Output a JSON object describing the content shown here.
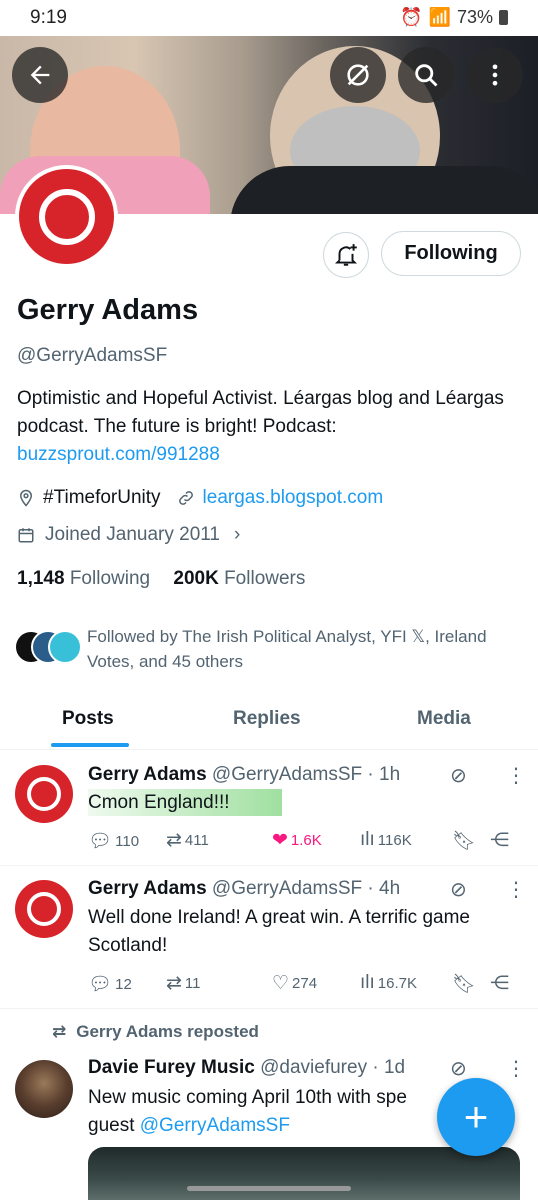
{
  "status_bar": {
    "time": "9:19",
    "battery": "73%"
  },
  "profile": {
    "name": "Gerry Adams",
    "handle": "@GerryAdamsSF",
    "bio": "Optimistic and Hopeful Activist. Léargas blog and Léargas podcast. The future is bright!  Podcast:",
    "bio_link": "buzzsprout.com/991288",
    "location": "#TimeforUnity",
    "website": "leargas.blogspot.com",
    "joined": "Joined January 2011",
    "following_count": "1,148",
    "following_label": "Following",
    "followers_count": "200K",
    "followers_label": "Followers",
    "followed_by": "Followed by The Irish Political Analyst, YFI 𝕏, Ireland Votes, and 45 others",
    "follow_button": "Following"
  },
  "tabs": [
    "Posts",
    "Replies",
    "Media"
  ],
  "posts": [
    {
      "name": "Gerry Adams",
      "meta": "@GerryAdamsSF · 1h",
      "text": "Cmon England!!!",
      "replies": "110",
      "reposts": "411",
      "likes": "1.6K",
      "views": "116K"
    },
    {
      "name": "Gerry Adams",
      "meta": "@GerryAdamsSF · 4h",
      "text": "Well done Ireland! A great win. A terrific game Scotland!",
      "replies": "12",
      "reposts": "11",
      "likes": "274",
      "views": "16.7K"
    }
  ],
  "repost": {
    "label": "Gerry Adams reposted",
    "name": "Davie Furey Music",
    "meta": "@daviefurey · 1d",
    "text": "New music coming April 10th with spe",
    "text_line2": "guest ",
    "mention": "@GerryAdamsSF"
  },
  "colors": {
    "accent": "#1d9bf0",
    "like": "#f91880",
    "avatar_red": "#d6242a"
  },
  "icons": [
    "back-arrow-icon",
    "grok-icon",
    "search-icon",
    "more-vertical-icon",
    "bell-plus-icon",
    "location-icon",
    "link-icon",
    "calendar-icon",
    "chevron-right-icon",
    "reply-icon",
    "repost-icon",
    "heart-icon",
    "views-icon",
    "bookmark-icon",
    "share-icon",
    "compose-plus-icon"
  ]
}
